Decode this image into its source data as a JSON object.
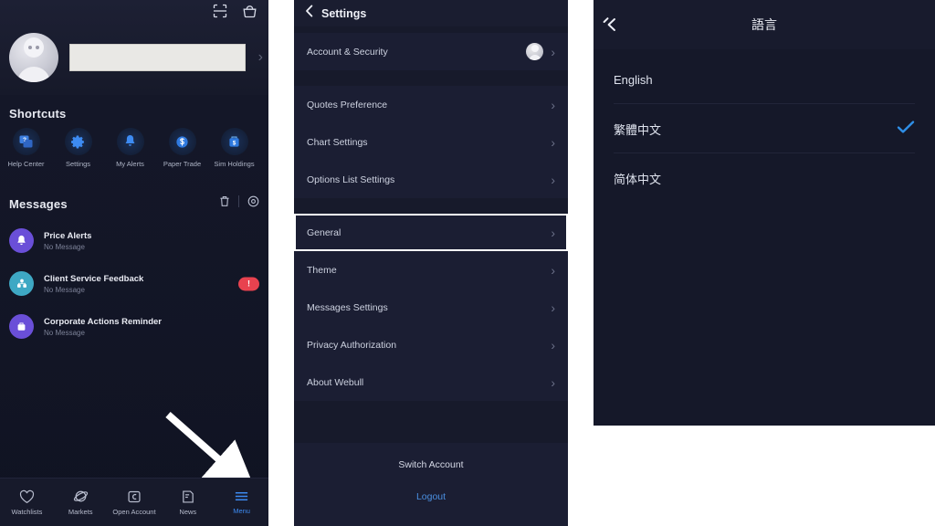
{
  "panel_menu": {
    "top_icons": [
      {
        "name": "scan-icon",
        "label": "Scan"
      },
      {
        "name": "gift-icon",
        "label": "Rewards"
      }
    ],
    "profile": {
      "avatar_name": "user-avatar",
      "username_redacted": "",
      "chevron": "›"
    },
    "shortcuts": {
      "title": "Shortcuts",
      "items": [
        {
          "label": "Help Center",
          "icon": "help-chat-icon"
        },
        {
          "label": "Settings",
          "icon": "gear-icon"
        },
        {
          "label": "My Alerts",
          "icon": "bell-icon"
        },
        {
          "label": "Paper Trade",
          "icon": "dollar-circle-icon"
        },
        {
          "label": "Sim Holdings",
          "icon": "dollar-bag-icon"
        }
      ]
    },
    "messages": {
      "title": "Messages",
      "header_icons": [
        {
          "name": "trash-icon"
        },
        {
          "name": "settings-circle-icon"
        }
      ],
      "items": [
        {
          "title": "Price Alerts",
          "subtitle": "No Message",
          "icon": "bell-icon",
          "color": "#6a4fd8",
          "badge": ""
        },
        {
          "title": "Client Service Feedback",
          "subtitle": "No Message",
          "icon": "service-icon",
          "color": "#3ea8c4",
          "badge": "!"
        },
        {
          "title": "Corporate Actions Reminder",
          "subtitle": "No Message",
          "icon": "briefcase-icon",
          "color": "#6a4fd8",
          "badge": ""
        }
      ]
    },
    "tabbar": [
      {
        "label": "Watchlists",
        "icon": "heart-icon",
        "active": false
      },
      {
        "label": "Markets",
        "icon": "planet-icon",
        "active": false
      },
      {
        "label": "Open Account",
        "icon": "card-icon",
        "active": false
      },
      {
        "label": "News",
        "icon": "news-icon",
        "active": false
      },
      {
        "label": "Menu",
        "icon": "hamburger-icon",
        "active": true
      }
    ],
    "annotation": {
      "name": "pointer-arrow",
      "target": "Menu"
    }
  },
  "panel_settings": {
    "header": {
      "back": "‹",
      "title": "Settings"
    },
    "group_account": [
      {
        "label": "Account & Security",
        "chevron": "›",
        "avatar": true,
        "highlight": false
      }
    ],
    "group_prefs": [
      {
        "label": "Quotes Preference",
        "chevron": "›",
        "avatar": false,
        "highlight": false
      },
      {
        "label": "Chart Settings",
        "chevron": "›",
        "avatar": false,
        "highlight": false
      },
      {
        "label": "Options List Settings",
        "chevron": "›",
        "avatar": false,
        "highlight": false
      }
    ],
    "group_general": [
      {
        "label": "General",
        "chevron": "›",
        "avatar": false,
        "highlight": true
      },
      {
        "label": "Theme",
        "chevron": "›",
        "avatar": false,
        "highlight": false
      },
      {
        "label": "Messages Settings",
        "chevron": "›",
        "avatar": false,
        "highlight": false
      },
      {
        "label": "Privacy Authorization",
        "chevron": "›",
        "avatar": false,
        "highlight": false
      },
      {
        "label": "About Webull",
        "chevron": "›",
        "avatar": false,
        "highlight": false
      }
    ],
    "footer": {
      "switch_account": "Switch Account",
      "logout": "Logout",
      "logout_color": "#4a8fe0"
    }
  },
  "panel_language": {
    "header": {
      "back": "‹",
      "title": "語言"
    },
    "options": [
      {
        "label": "English",
        "selected": false
      },
      {
        "label": "繁體中文",
        "selected": true
      },
      {
        "label": "简体中文",
        "selected": false
      }
    ],
    "check_glyph": "✓",
    "check_color": "#2f8fe8"
  }
}
